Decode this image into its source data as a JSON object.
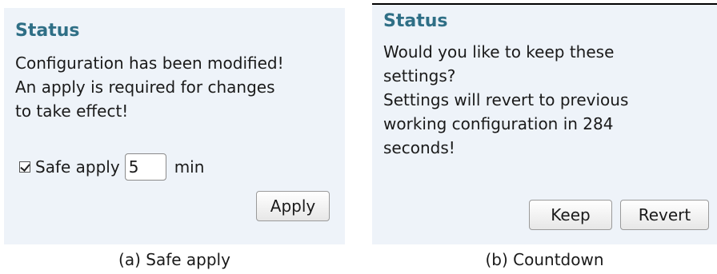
{
  "panel_a": {
    "title": "Status",
    "lines": [
      "Configuration has been modified!",
      "An apply is required for changes",
      "to take effect!"
    ],
    "safe_apply": {
      "checked": true,
      "label": "Safe apply",
      "value": "5",
      "unit": "min"
    },
    "apply_label": "Apply",
    "caption": "(a) Safe apply"
  },
  "panel_b": {
    "title": "Status",
    "lines": [
      "Would you like to keep these",
      "settings?",
      "Settings will revert to previous",
      "working configuration in 284",
      "seconds!"
    ],
    "keep_label": "Keep",
    "revert_label": "Revert",
    "caption": "(b) Countdown"
  },
  "colors": {
    "panel_background": "#eef3f9",
    "title": "#2f6f86"
  }
}
